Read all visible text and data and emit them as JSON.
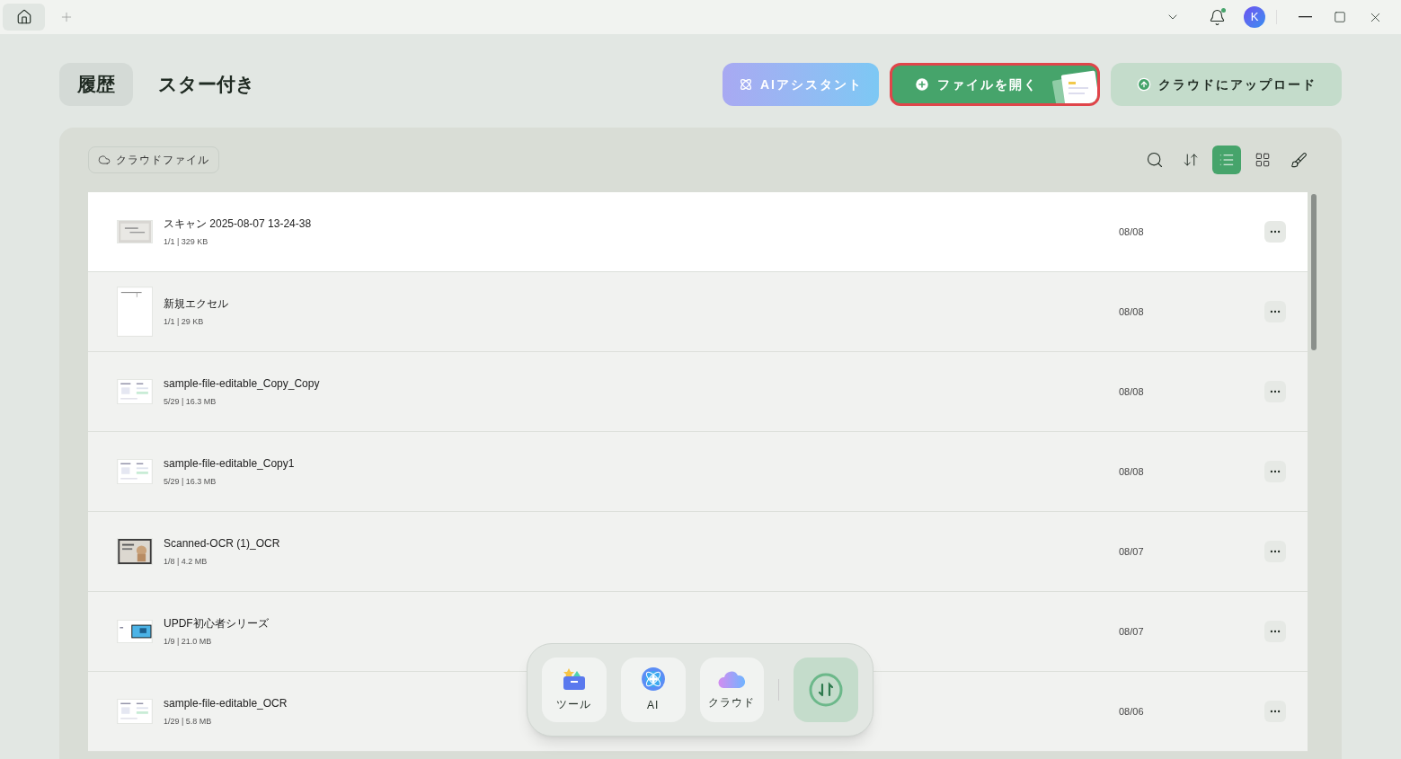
{
  "titlebar": {
    "avatar": "K",
    "notification_dot": true
  },
  "tabs": [
    {
      "label": "履歴",
      "selected": true
    },
    {
      "label": "スター付き",
      "selected": false
    }
  ],
  "actions": [
    {
      "kind": "ai",
      "label": "AIアシスタント"
    },
    {
      "kind": "open",
      "label": "ファイルを開く",
      "highlighted": true
    },
    {
      "kind": "upload",
      "label": "クラウドにアップロード"
    }
  ],
  "cloud_chip": "クラウドファイル",
  "view_toggle": [
    {
      "kind": "list",
      "selected": true
    },
    {
      "kind": "grid",
      "selected": false
    }
  ],
  "files": [
    {
      "name": "スキャン 2025-08-07 13-24-38",
      "meta": "1/1 | 329 KB",
      "date": "08/08",
      "kind": "scan",
      "selected": true
    },
    {
      "name": "新規エクセル",
      "meta": "1/1 | 29 KB",
      "date": "08/08",
      "kind": "blank",
      "selected": false
    },
    {
      "name": "sample-file-editable_Copy_Copy",
      "meta": "5/29 | 16.3 MB",
      "date": "08/08",
      "kind": "doc",
      "selected": false
    },
    {
      "name": "sample-file-editable_Copy1",
      "meta": "5/29 | 16.3 MB",
      "date": "08/08",
      "kind": "doc",
      "selected": false
    },
    {
      "name": "Scanned-OCR (1)_OCR",
      "meta": "1/8 | 4.2 MB",
      "date": "08/07",
      "kind": "photo",
      "selected": false
    },
    {
      "name": "UPDF初心者シリーズ",
      "meta": "1/9 | 21.0 MB",
      "date": "08/07",
      "kind": "slides",
      "selected": false
    },
    {
      "name": "sample-file-editable_OCR",
      "meta": "1/29 | 5.8 MB",
      "date": "08/06",
      "kind": "doc",
      "selected": false
    }
  ],
  "dock": [
    {
      "kind": "tools",
      "label": "ツール"
    },
    {
      "kind": "ai",
      "label": "AI"
    },
    {
      "kind": "cloud",
      "label": "クラウド"
    }
  ]
}
